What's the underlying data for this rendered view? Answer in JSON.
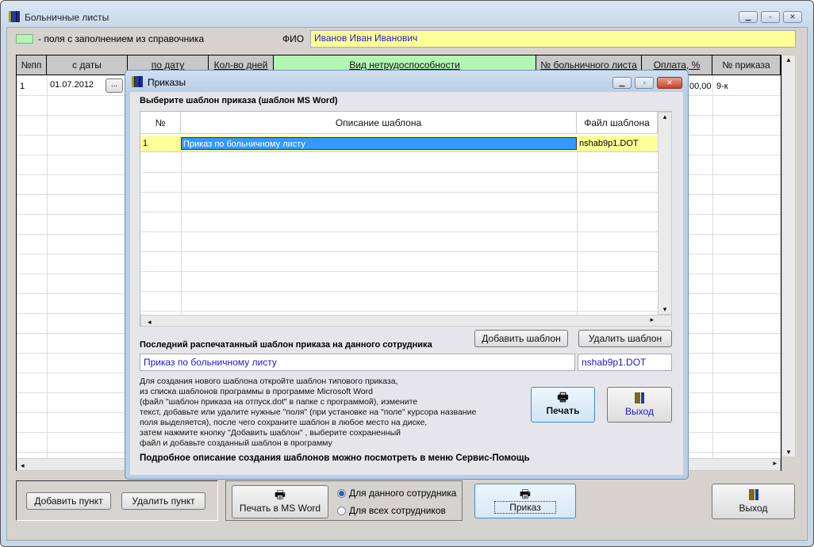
{
  "main": {
    "title": "Больничные листы",
    "legend_text": "- поля с заполнением из справочника",
    "fio_label": "ФИО",
    "fio_value": "Иванов Иван Иванович",
    "legend_color": "#b3f5b3",
    "columns": [
      "№пп",
      "с даты",
      "по дату",
      "Кол-во дней",
      "Вид нетрудоспособности",
      "№ больничного листа",
      "Оплата, %",
      "№ приказа"
    ],
    "row": {
      "num": "1",
      "from": "01.07.2012",
      "pick": "...",
      "pay": "00,00",
      "order": "9-к"
    },
    "buttons": {
      "add_item": "Добавить пункт",
      "del_item": "Удалить пункт",
      "print_word": "Печать в MS Word",
      "radio_this": "Для данного сотрудника",
      "radio_all": "Для всех сотрудников",
      "order": "Приказ",
      "exit": "Выход"
    }
  },
  "dialog": {
    "title": "Приказы",
    "choose_label": "Выберите шаблон приказа (шаблон MS Word)",
    "columns": [
      "№",
      "Описание шаблона",
      "Файл шаблона"
    ],
    "rows": [
      {
        "num": "1",
        "desc": "Приказ по больничному листу",
        "file": "nshab9p1.DOT"
      }
    ],
    "add_template": "Добавить шаблон",
    "del_template": "Удалить шаблон",
    "last_label": "Последний распечатанный шаблон приказа на  данного сотрудника",
    "last_desc": "Приказ по больничному листу",
    "last_file": "nshab9p1.DOT",
    "help": [
      "Для создания нового шаблона откройте шаблон типового приказа,",
      "из списка шаблонов программы в программе Microsoft Word",
      "(файл \"шаблон приказа на отпуск.dot\" в папке  с программой),  измените",
      "текст, добавьте или удалите нужные \"поля\" (при установке на \"поле\" курсора название",
      "поля выделяется), после чего сохраните шаблон в любое место на диске,",
      "затем нажмите кнопку \"Добавить шаблон\" , выберите сохраненный",
      "файл и добавьте созданный шаблон в программу"
    ],
    "help_bold": "Подробное описание создания шаблонов можно посмотреть в меню Сервис-Помощь",
    "print": "Печать",
    "exit": "Выход"
  }
}
